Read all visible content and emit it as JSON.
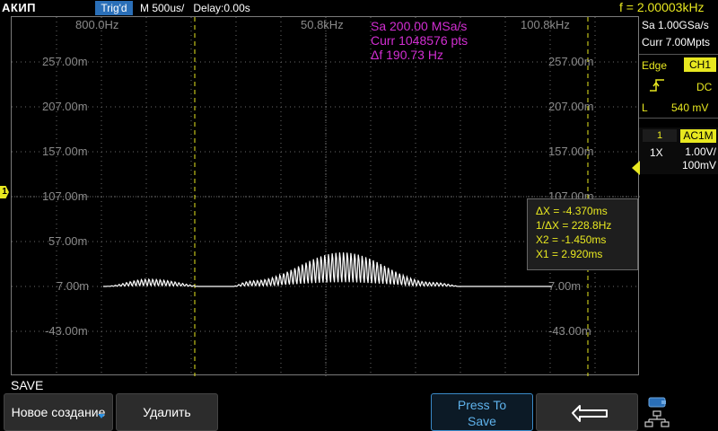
{
  "topbar": {
    "brand": "АКИП",
    "trig_status": "Trig'd",
    "timebase": "M 500us/",
    "delay": "Delay:0.00s",
    "frequency": "f = 2.00003kHz"
  },
  "plot": {
    "y_labels_left": [
      "257.00m",
      "207.00m",
      "157.00m",
      "107.00m",
      "57.00m",
      "7.00m",
      "-43.00m"
    ],
    "y_labels_right": [
      "257.00m",
      "207.00m",
      "157.00m",
      "107.00m",
      "57.00m",
      "7.00m",
      "-43.00m"
    ],
    "x_labels": [
      "800.0Hz",
      "50.8kHz",
      "100.8kHz"
    ],
    "fft_info": {
      "sample_rate": "Sa 200.00 MSa/s",
      "points": "Curr 1048576 pts",
      "delta_f": "Δf 190.73 Hz"
    },
    "cursors": {
      "delta_x": "ΔX = -4.370ms",
      "inv_delta_x": "1/ΔX = 228.8Hz",
      "x2": "X2 = -1.450ms",
      "x1": "X1 = 2.920ms"
    },
    "waveform": {
      "color": "#ffffff",
      "unit": "V",
      "baseline": 0.007,
      "envelope_peak": 0.052,
      "description_points": [
        {
          "div": 0.0,
          "v": 0.007
        },
        {
          "div": 0.6,
          "v": 0.016
        },
        {
          "div": 1.6,
          "v": 0.004
        },
        {
          "div": 2.0,
          "v": 0.014
        },
        {
          "div": 3.2,
          "v": 0.05
        },
        {
          "div": 4.4,
          "v": 0.012
        },
        {
          "div": 5.0,
          "v": 0.004
        },
        {
          "div": 6.0,
          "v": 0.007
        }
      ]
    },
    "channel_marker": "1",
    "colors": {
      "cursor": "#e8e820",
      "fft_text": "#d22ed2",
      "grid": "#6a6a6a",
      "trigger_marker": "#2aa3e0"
    }
  },
  "side": {
    "sample": "Sa 1.00GSa/s",
    "memory": "Curr 7.00Mpts",
    "trigger": {
      "type": "Edge",
      "source": "CH1",
      "coupling": "DC",
      "level_label": "L",
      "level": "540 mV"
    },
    "channel": {
      "number": "1",
      "coupling": "AC1M",
      "probe": "1X",
      "scale_line1": "1.00V/",
      "scale_line2": "100mV"
    }
  },
  "menu": {
    "title": "SAVE",
    "buttons": {
      "new": "Новое создание",
      "delete": "Удалить",
      "press_line1": "Press To",
      "press_line2": "Save"
    }
  }
}
